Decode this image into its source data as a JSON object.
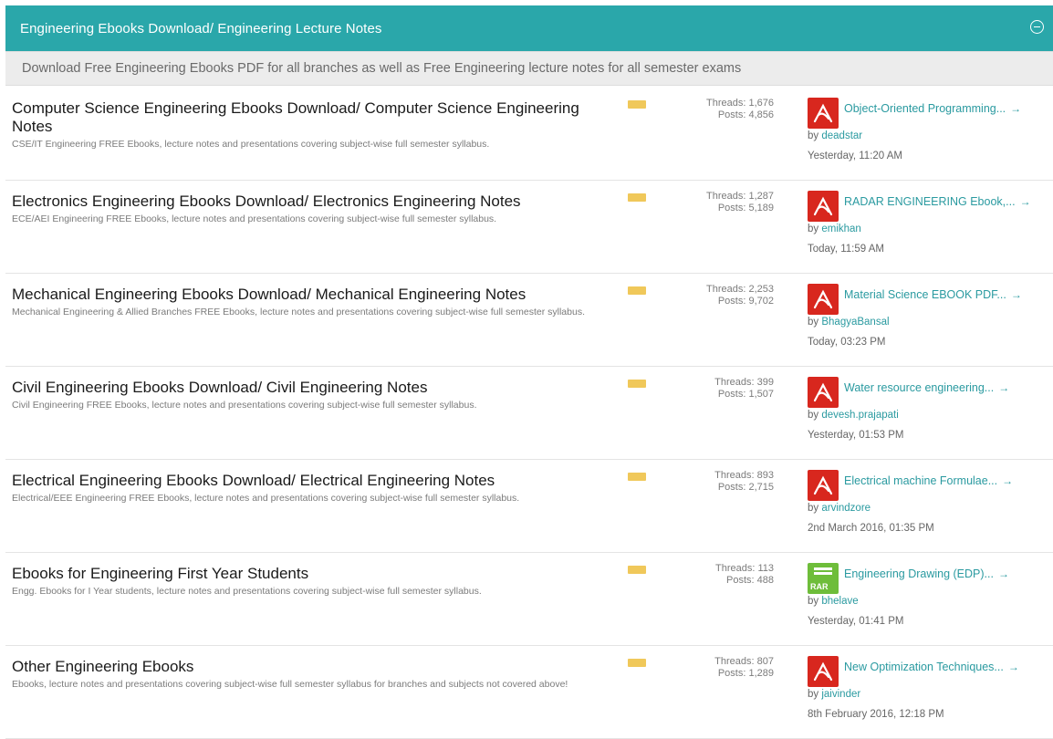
{
  "header": {
    "title": "Engineering Ebooks Download/ Engineering Lecture Notes"
  },
  "subheader": {
    "text": "Download Free Engineering Ebooks PDF for all branches as well as Free Engineering lecture notes for all semester exams"
  },
  "forums": [
    {
      "title": "Computer Science Engineering Ebooks Download/ Computer Science Engineering Notes",
      "description": "CSE/IT Engineering FREE Ebooks, lecture notes and presentations covering subject-wise full semester syllabus.",
      "threads": "Threads: 1,676",
      "posts": "Posts: 4,856",
      "last_post": {
        "title": "Object-Oriented Programming...",
        "by": "by",
        "user": "deadstar",
        "date": "Yesterday, 11:20 AM",
        "icon": "pdf-icon"
      }
    },
    {
      "title": "Electronics Engineering Ebooks Download/ Electronics Engineering Notes",
      "description": "ECE/AEI Engineering FREE Ebooks, lecture notes and presentations covering subject-wise full semester syllabus.",
      "threads": "Threads: 1,287",
      "posts": "Posts: 5,189",
      "last_post": {
        "title": "RADAR ENGINEERING Ebook,...",
        "by": "by",
        "user": "emikhan",
        "date": "Today, 11:59 AM",
        "icon": "pdf-icon"
      }
    },
    {
      "title": "Mechanical Engineering Ebooks Download/ Mechanical Engineering Notes",
      "description": "Mechanical Engineering & Allied Branches FREE Ebooks, lecture notes and presentations covering subject-wise full semester syllabus.",
      "threads": "Threads: 2,253",
      "posts": "Posts: 9,702",
      "last_post": {
        "title": "Material Science EBOOK PDF...",
        "by": "by",
        "user": "BhagyaBansal",
        "date": "Today, 03:23 PM",
        "icon": "pdf-icon"
      }
    },
    {
      "title": "Civil Engineering Ebooks Download/ Civil Engineering Notes",
      "description": "Civil Engineering FREE Ebooks, lecture notes and presentations covering subject-wise full semester syllabus.",
      "threads": "Threads: 399",
      "posts": "Posts: 1,507",
      "last_post": {
        "title": "Water resource engineering...",
        "by": "by",
        "user": "devesh.prajapati",
        "date": "Yesterday, 01:53 PM",
        "icon": "pdf-icon"
      }
    },
    {
      "title": "Electrical Engineering Ebooks Download/ Electrical Engineering Notes",
      "description": "Electrical/EEE Engineering FREE Ebooks, lecture notes and presentations covering subject-wise full semester syllabus.",
      "threads": "Threads: 893",
      "posts": "Posts: 2,715",
      "last_post": {
        "title": "Electrical machine Formulae...",
        "by": "by",
        "user": "arvindzore",
        "date": "2nd March 2016, 01:35 PM",
        "icon": "pdf-icon"
      }
    },
    {
      "title": "Ebooks for Engineering First Year Students",
      "description": "Engg. Ebooks for I Year students, lecture notes and presentations covering subject-wise full semester syllabus.",
      "threads": "Threads: 113",
      "posts": "Posts: 488",
      "last_post": {
        "title": "Engineering Drawing (EDP)...",
        "by": "by",
        "user": "bhelave",
        "date": "Yesterday, 01:41 PM",
        "icon": "rar-icon",
        "icon_label": "RAR"
      }
    },
    {
      "title": "Other Engineering Ebooks",
      "description": "Ebooks, lecture notes and presentations covering subject-wise full semester syllabus for branches and subjects not covered above!",
      "threads": "Threads: 807",
      "posts": "Posts: 1,289",
      "last_post": {
        "title": "New Optimization Techniques...",
        "by": "by",
        "user": "jaivinder",
        "date": "8th February 2016, 12:18 PM",
        "icon": "pdf-icon"
      }
    }
  ],
  "colors": {
    "header_bg": "#2aa7aa",
    "link": "#2a9aa0",
    "pdf": "#d8271e",
    "rar": "#6ebd3a",
    "rss": "#f0c85a"
  },
  "icons": {
    "collapse": "collapse-minus-icon",
    "rss": "rss-feed-icon",
    "arrow": "go-to-last-post-arrow-icon"
  }
}
